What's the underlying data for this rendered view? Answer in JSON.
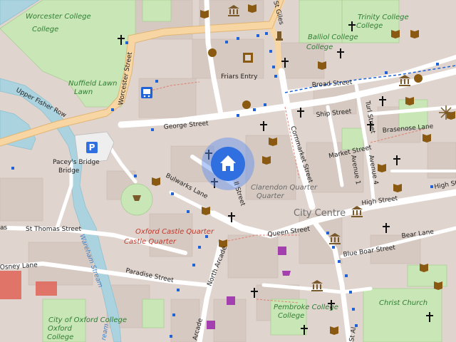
{
  "map": {
    "areas": {
      "worcester_college": "Worcester College",
      "nuffield_lawn": "Nuffield Lawn",
      "balliol_college": "Balliol College",
      "trinity_college": "Trinity College",
      "clarendon_quarter": "Clarendon Quarter",
      "city_centre": "City Centre",
      "oxford_castle_quarter": "Oxford Castle Quarter",
      "pembroke_college": "Pembroke College",
      "city_of_oxford_college": "City of Oxford College",
      "christ_church": "Christ Church"
    },
    "streets": {
      "worcester_street": "Worcester Street",
      "upper_fisher_row": "Upper Fisher Row",
      "george_street": "George Street",
      "friars_entry": "Friars Entry",
      "broad_street": "Broad Street",
      "ship_street": "Ship Street",
      "cornmarket_street": "Cornmarket Street",
      "turl_street": "Turl Street",
      "brasenose_lane": "Brasenose Lane",
      "market_street": "Market Street",
      "avenue_1": "Avenue 1",
      "avenue_4": "Avenue 4",
      "high_street": "High Street",
      "high_st": "High St",
      "bear_lane": "Bear Lane",
      "blue_boar_street": "Blue Boar Street",
      "queen_street": "Queen Street",
      "st_thomas_street": "St Thomas Street",
      "osney_lane": "Osney Lane",
      "paradise_street": "Paradise Street",
      "bulwarks_lane": "Bulwarks Lane",
      "north_arcade": "North Arcade",
      "arcade": "Arcade",
      "st_giles": "St Giles",
      "st_al": "St Al",
      "new_inn_hall_street": "ll Street",
      "paceys_bridge": "Pacey's Bridge",
      "warrens_stream": "Wareham Stream",
      "as_fragment": "as"
    },
    "parking_label": "P",
    "colors": {
      "background": "#e0d4ce",
      "building": "#d6c9c1",
      "park": "#c9e7b6",
      "water": "#aad3df",
      "main_road": "#f8d6a4",
      "road": "#ffffff",
      "location_marker": "#2f6fe0",
      "location_halo": "#5b8ff0",
      "bus_stop_blue": "#1f63d6",
      "red_building": "#e06a5f"
    },
    "location_marker_icon": "home-icon"
  }
}
